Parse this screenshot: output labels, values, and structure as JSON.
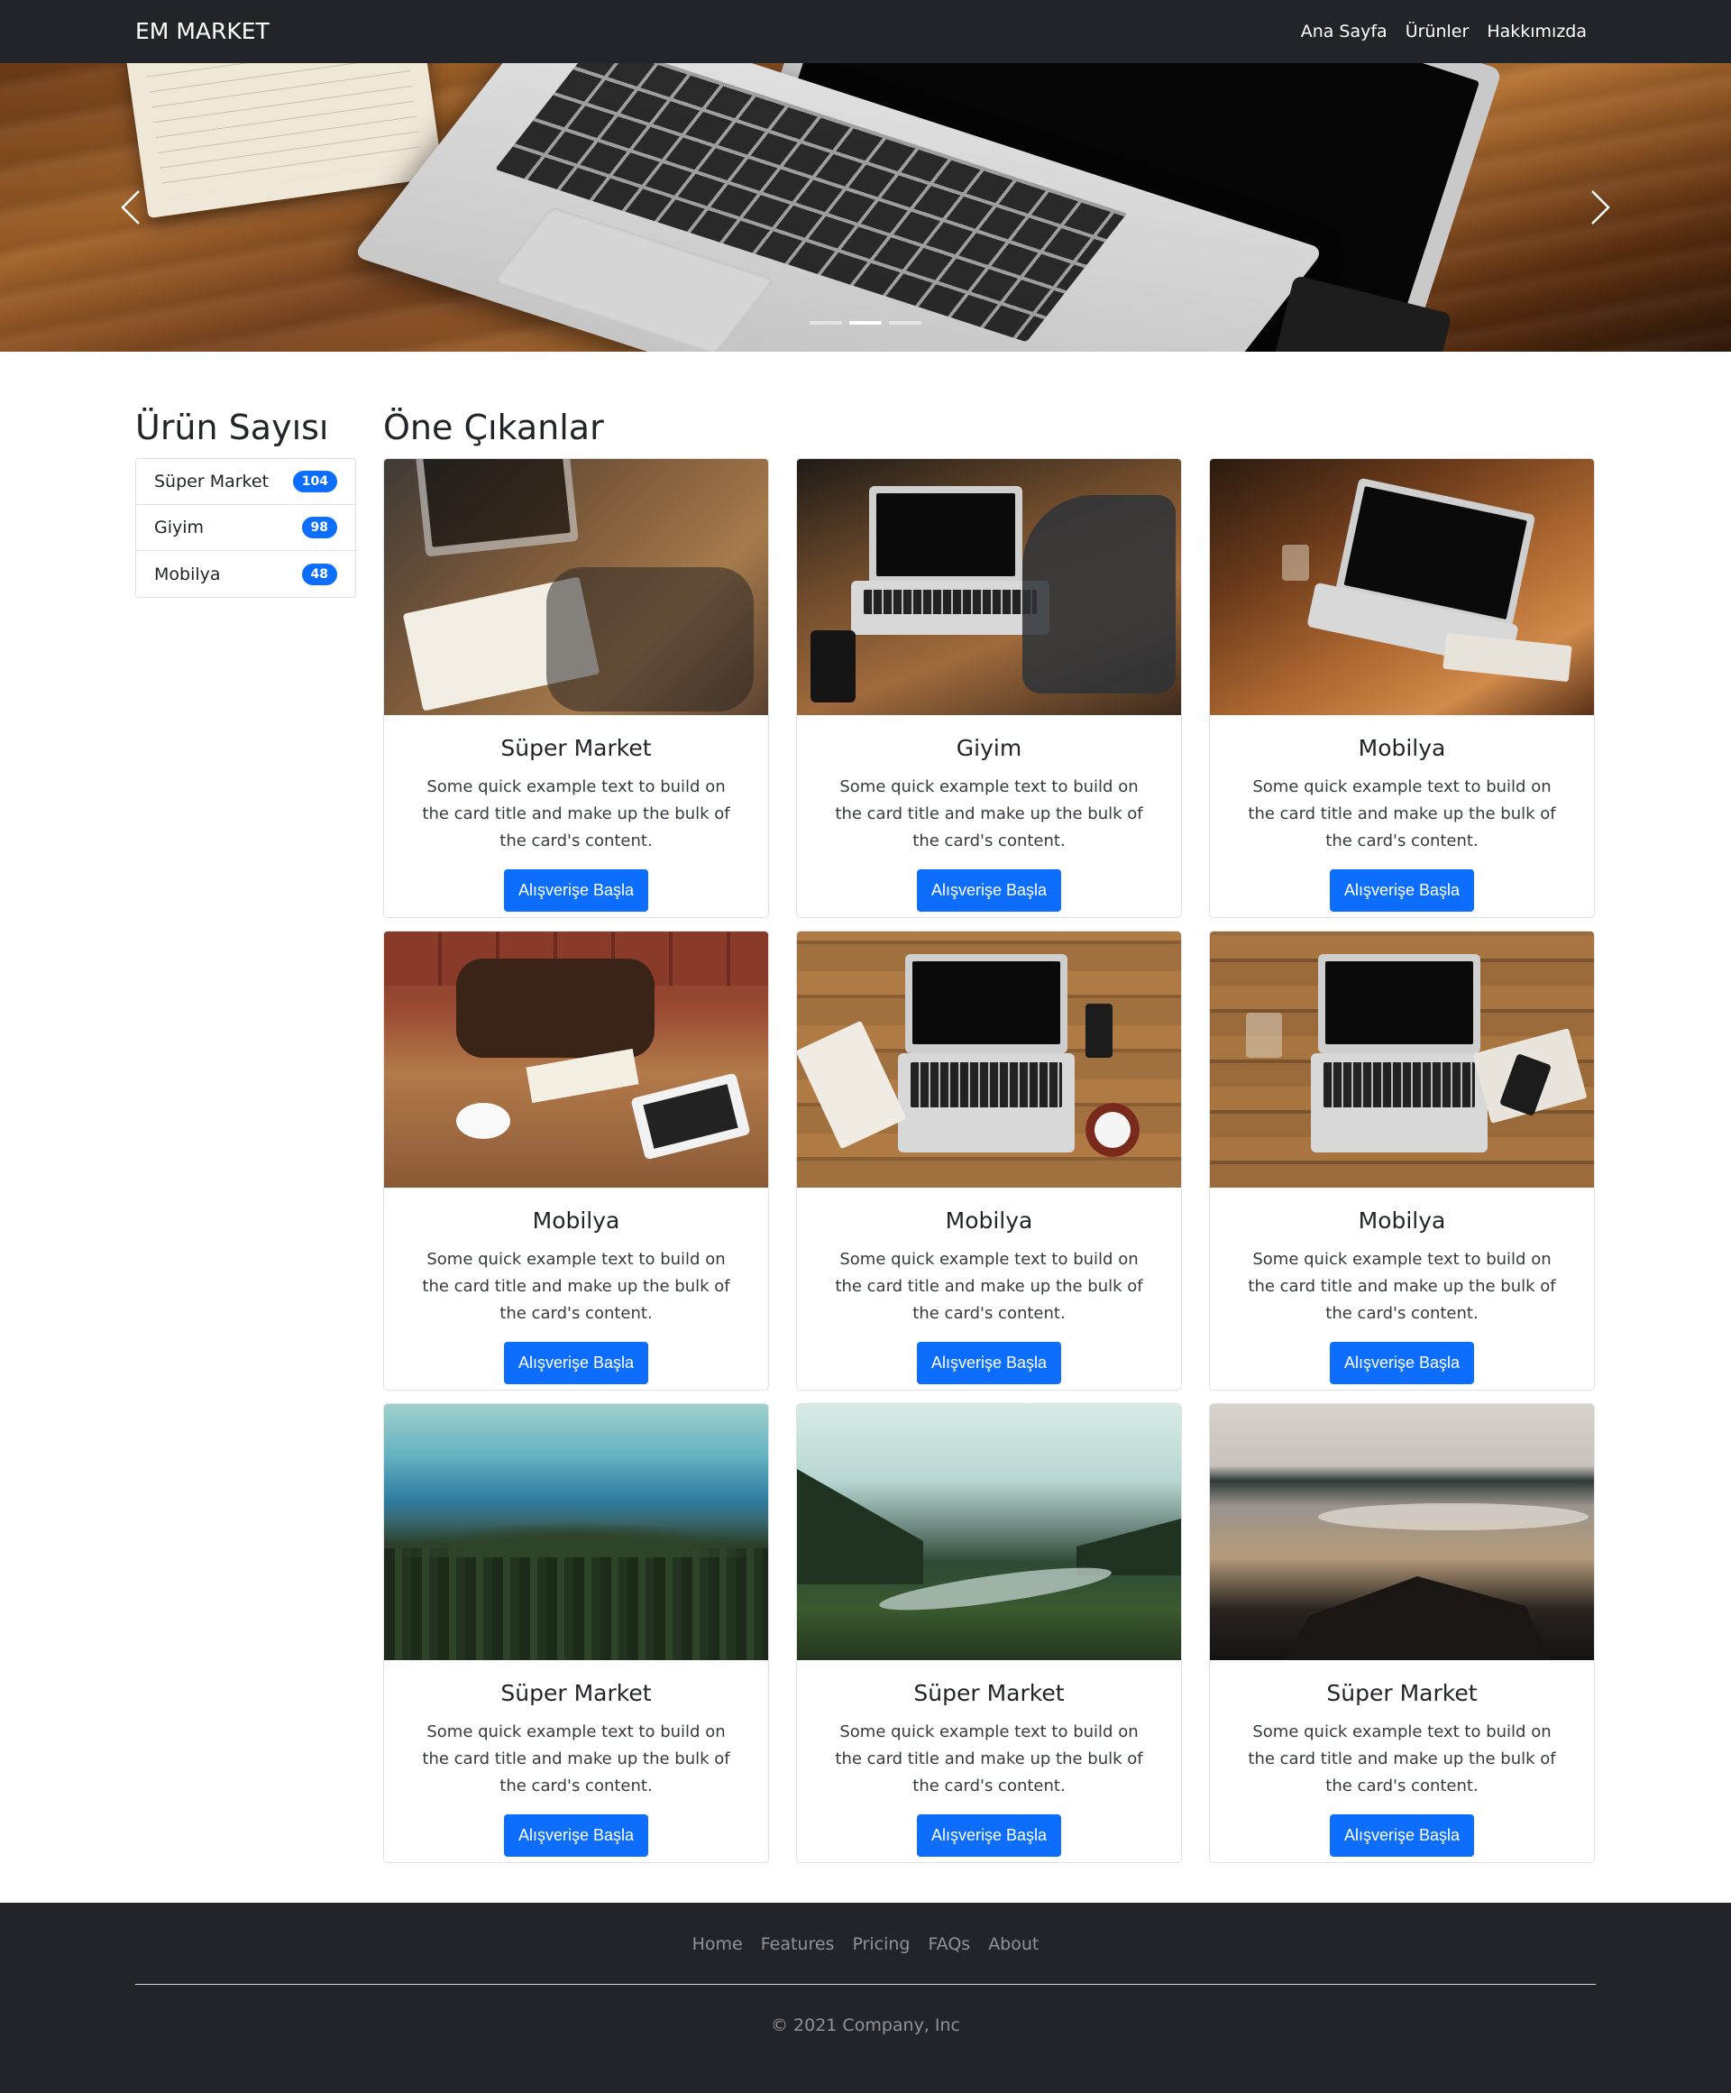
{
  "navbar": {
    "brand": "EM MARKET",
    "links": [
      "Ana Sayfa",
      "Ürünler",
      "Hakkımızda"
    ]
  },
  "carousel": {
    "indicator_count": 3,
    "active_index": 1
  },
  "sidebar": {
    "title": "Ürün Sayısı",
    "items": [
      {
        "label": "Süper Market",
        "count": "104"
      },
      {
        "label": "Giyim",
        "count": "98"
      },
      {
        "label": "Mobilya",
        "count": "48"
      }
    ]
  },
  "featured": {
    "title": "Öne Çıkanlar",
    "cards": [
      {
        "title": "Süper Market",
        "text": "Some quick example text to build on the card title and make up the bulk of the card's content.",
        "button": "Alışverişe Başla"
      },
      {
        "title": "Giyim",
        "text": "Some quick example text to build on the card title and make up the bulk of the card's content.",
        "button": "Alışverişe Başla"
      },
      {
        "title": "Mobilya",
        "text": "Some quick example text to build on the card title and make up the bulk of the card's content.",
        "button": "Alışverişe Başla"
      },
      {
        "title": "Mobilya",
        "text": "Some quick example text to build on the card title and make up the bulk of the card's content.",
        "button": "Alışverişe Başla"
      },
      {
        "title": "Mobilya",
        "text": "Some quick example text to build on the card title and make up the bulk of the card's content.",
        "button": "Alışverişe Başla"
      },
      {
        "title": "Mobilya",
        "text": "Some quick example text to build on the card title and make up the bulk of the card's content.",
        "button": "Alışverişe Başla"
      },
      {
        "title": "Süper Market",
        "text": "Some quick example text to build on the card title and make up the bulk of the card's content.",
        "button": "Alışverişe Başla"
      },
      {
        "title": "Süper Market",
        "text": "Some quick example text to build on the card title and make up the bulk of the card's content.",
        "button": "Alışverişe Başla"
      },
      {
        "title": "Süper Market",
        "text": "Some quick example text to build on the card title and make up the bulk of the card's content.",
        "button": "Alışverişe Başla"
      }
    ]
  },
  "footer": {
    "links": [
      "Home",
      "Features",
      "Pricing",
      "FAQs",
      "About"
    ],
    "copyright": "© 2021 Company, Inc"
  },
  "colors": {
    "navbar_bg": "#212529",
    "primary": "#0d6efd",
    "footer_text": "#8e949a"
  }
}
